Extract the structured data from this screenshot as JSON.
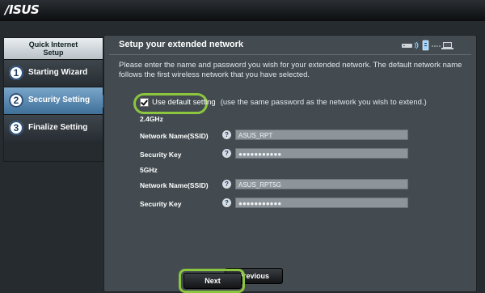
{
  "header": {
    "logo": "/ISUS"
  },
  "sidebar": {
    "title_line1": "Quick Internet",
    "title_line2": "Setup",
    "items": [
      {
        "num": "1",
        "label": "Starting Wizard",
        "active": false
      },
      {
        "num": "2",
        "label": "Security Setting",
        "active": true
      },
      {
        "num": "3",
        "label": "Finalize Setting",
        "active": false
      }
    ]
  },
  "panel": {
    "title": "Setup your extended network",
    "description": "Please enter the name and password you wish for your extended network. The default network name follows the first wireless network that you have selected.",
    "checkbox_label": "Use default setting",
    "checkbox_checked": true,
    "checkbox_note": "(use the same password as the network you wish to extend.)",
    "band_24": "2.4GHz",
    "band_5": "5GHz",
    "ssid_label": "Network Name(SSID)",
    "key_label": "Security Key",
    "help_glyph": "?",
    "ssid_24": "ASUS_RPT",
    "key_24": "●●●●●●●●●●●",
    "ssid_5": "ASUS_RPT5G",
    "key_5": "●●●●●●●●●●●",
    "previous_label": "Previous",
    "next_label": "Next"
  },
  "colors": {
    "highlight": "#8cc63e",
    "active_nav": "#5a8bb5",
    "panel_bg": "#434b50"
  },
  "icons": [
    "router-icon",
    "wifi-icon",
    "repeater-icon",
    "laptop-icon",
    "help-icon",
    "check-icon"
  ]
}
